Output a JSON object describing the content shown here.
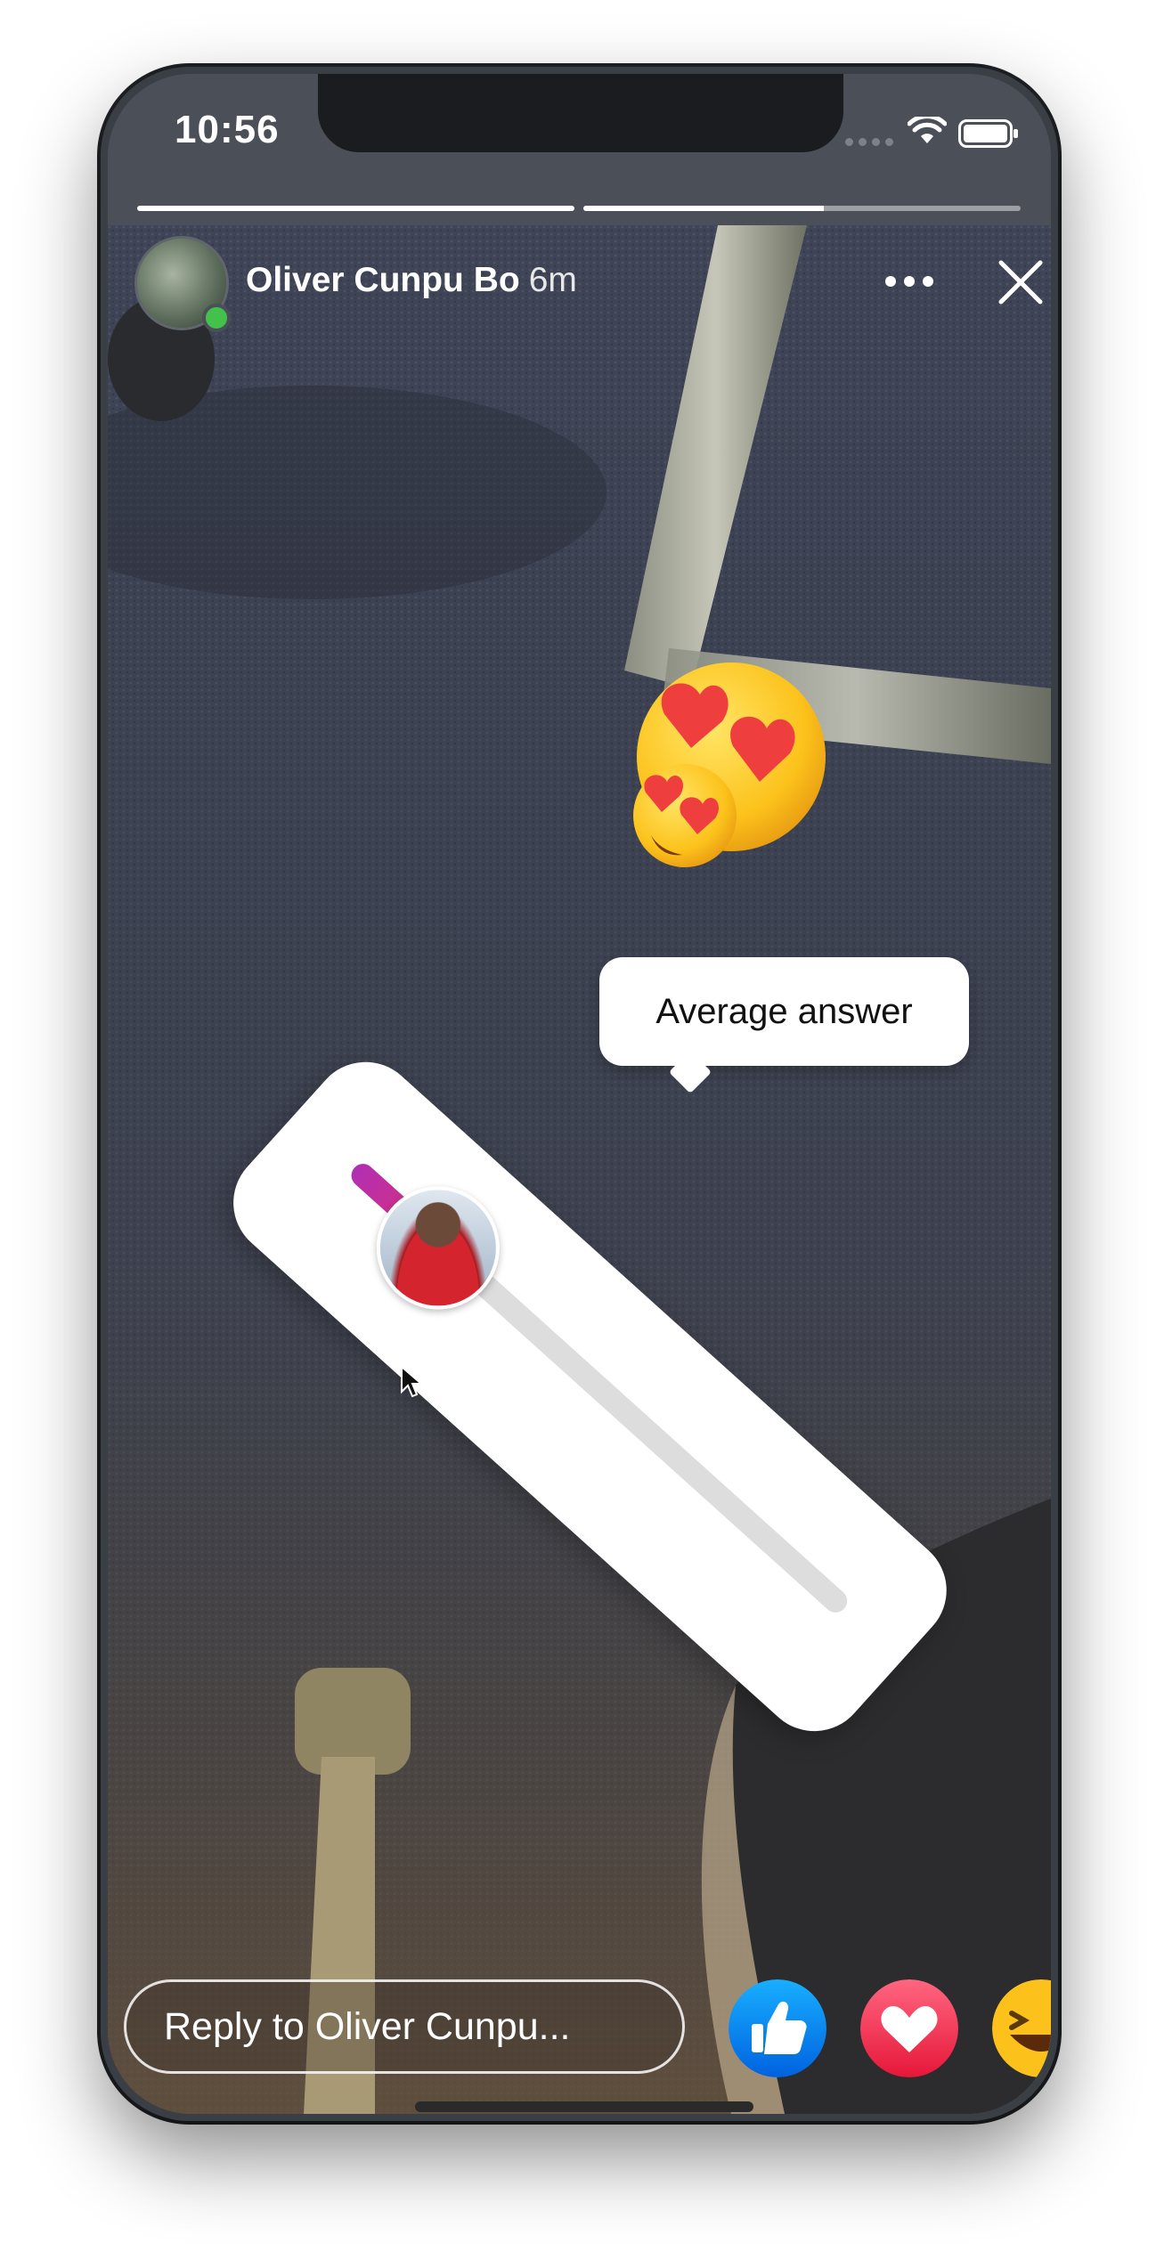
{
  "status_bar": {
    "time": "10:56"
  },
  "story": {
    "progress_segments": [
      1.0,
      0.55
    ],
    "author": "Oliver Cunpu Bo",
    "age": "6m",
    "online": true
  },
  "slider_sticker": {
    "emoji": "heart-eyes-emoji",
    "average_label": "Average answer",
    "average_value": 0.17,
    "fill_gradient": [
      "#b12fb5",
      "#e1306c"
    ]
  },
  "reply": {
    "placeholder": "Reply to Oliver  Cunpu..."
  },
  "reactions": [
    "like-icon",
    "love-icon",
    "haha-icon"
  ],
  "colors": {
    "like": "#1877f2",
    "love": "#f33e58",
    "online": "#43c24b"
  }
}
